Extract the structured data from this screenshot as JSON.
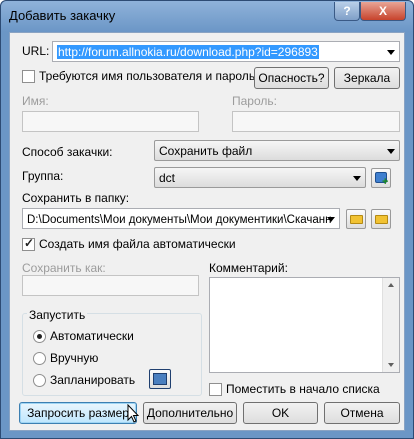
{
  "window": {
    "title": "Добавить закачку",
    "help": "?",
    "close": "X"
  },
  "url": {
    "label": "URL:",
    "value": "http://forum.allnokia.ru/download.php?id=296893"
  },
  "auth": {
    "checkbox_label": "Требуются имя пользователя и пароль",
    "checked": false,
    "danger_button": "Опасность?",
    "mirrors_button": "Зеркала",
    "name_label": "Имя:",
    "password_label": "Пароль:"
  },
  "download_method": {
    "label": "Способ закачки:",
    "value": "Сохранить файл"
  },
  "group": {
    "label": "Группа:",
    "value": "dct",
    "add_icon": "add-group-icon"
  },
  "save_folder": {
    "label": "Сохранить в папку:",
    "value": "D:\\Documents\\Мои документы\\Мои документики\\Скачанн"
  },
  "auto_name": {
    "label": "Создать имя файла автоматически",
    "checked": true
  },
  "save_as": {
    "label": "Сохранить как:"
  },
  "comment": {
    "label": "Комментарий:"
  },
  "start": {
    "legend": "Запустить",
    "options": [
      {
        "label": "Автоматически",
        "selected": true
      },
      {
        "label": "Вручную",
        "selected": false
      },
      {
        "label": "Запланировать",
        "selected": false
      }
    ]
  },
  "top_of_list": {
    "label": "Поместить в начало списка",
    "checked": false
  },
  "buttons": {
    "query_size": "Запросить размер",
    "advanced": "Дополнительно",
    "ok": "OK",
    "cancel": "Отмена"
  },
  "colors": {
    "titlebar": "#6b96c6",
    "selection": "#3399ff",
    "close": "#c7432c"
  }
}
